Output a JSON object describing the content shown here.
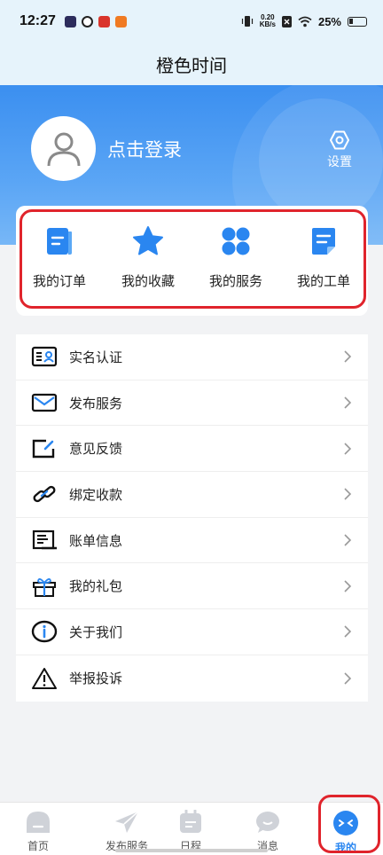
{
  "status_bar": {
    "time": "12:27",
    "net_speed_value": "0.20",
    "net_speed_unit": "KB/s",
    "battery": "25%"
  },
  "page": {
    "title": "橙色时间"
  },
  "profile": {
    "login_label": "点击登录",
    "settings_label": "设置"
  },
  "quick_actions": [
    {
      "label": "我的订单",
      "icon": "order-icon"
    },
    {
      "label": "我的收藏",
      "icon": "star-icon"
    },
    {
      "label": "我的服务",
      "icon": "grid-icon"
    },
    {
      "label": "我的工单",
      "icon": "workorder-icon"
    }
  ],
  "menu": [
    {
      "label": "实名认证",
      "icon": "id-card-icon"
    },
    {
      "label": "发布服务",
      "icon": "envelope-icon"
    },
    {
      "label": "意见反馈",
      "icon": "feedback-edit-icon"
    },
    {
      "label": "绑定收款",
      "icon": "link-icon"
    },
    {
      "label": "账单信息",
      "icon": "bill-icon"
    },
    {
      "label": "我的礼包",
      "icon": "gift-icon"
    },
    {
      "label": "关于我们",
      "icon": "info-icon"
    },
    {
      "label": "举报投诉",
      "icon": "warning-icon"
    }
  ],
  "tabbar": [
    {
      "label": "首页",
      "icon": "home-icon",
      "active": false
    },
    {
      "label": "发布服务",
      "icon": "paper-plane-icon",
      "active": false
    },
    {
      "label": "日程",
      "icon": "calendar-icon",
      "active": false
    },
    {
      "label": "消息",
      "icon": "chat-icon",
      "active": false
    },
    {
      "label": "我的",
      "icon": "profile-icon",
      "active": true
    }
  ],
  "colors": {
    "accent": "#2a86f0",
    "header_top": "#3b8ff0",
    "highlight_box": "#e0242c",
    "status_bg": "#e6f3fb"
  }
}
